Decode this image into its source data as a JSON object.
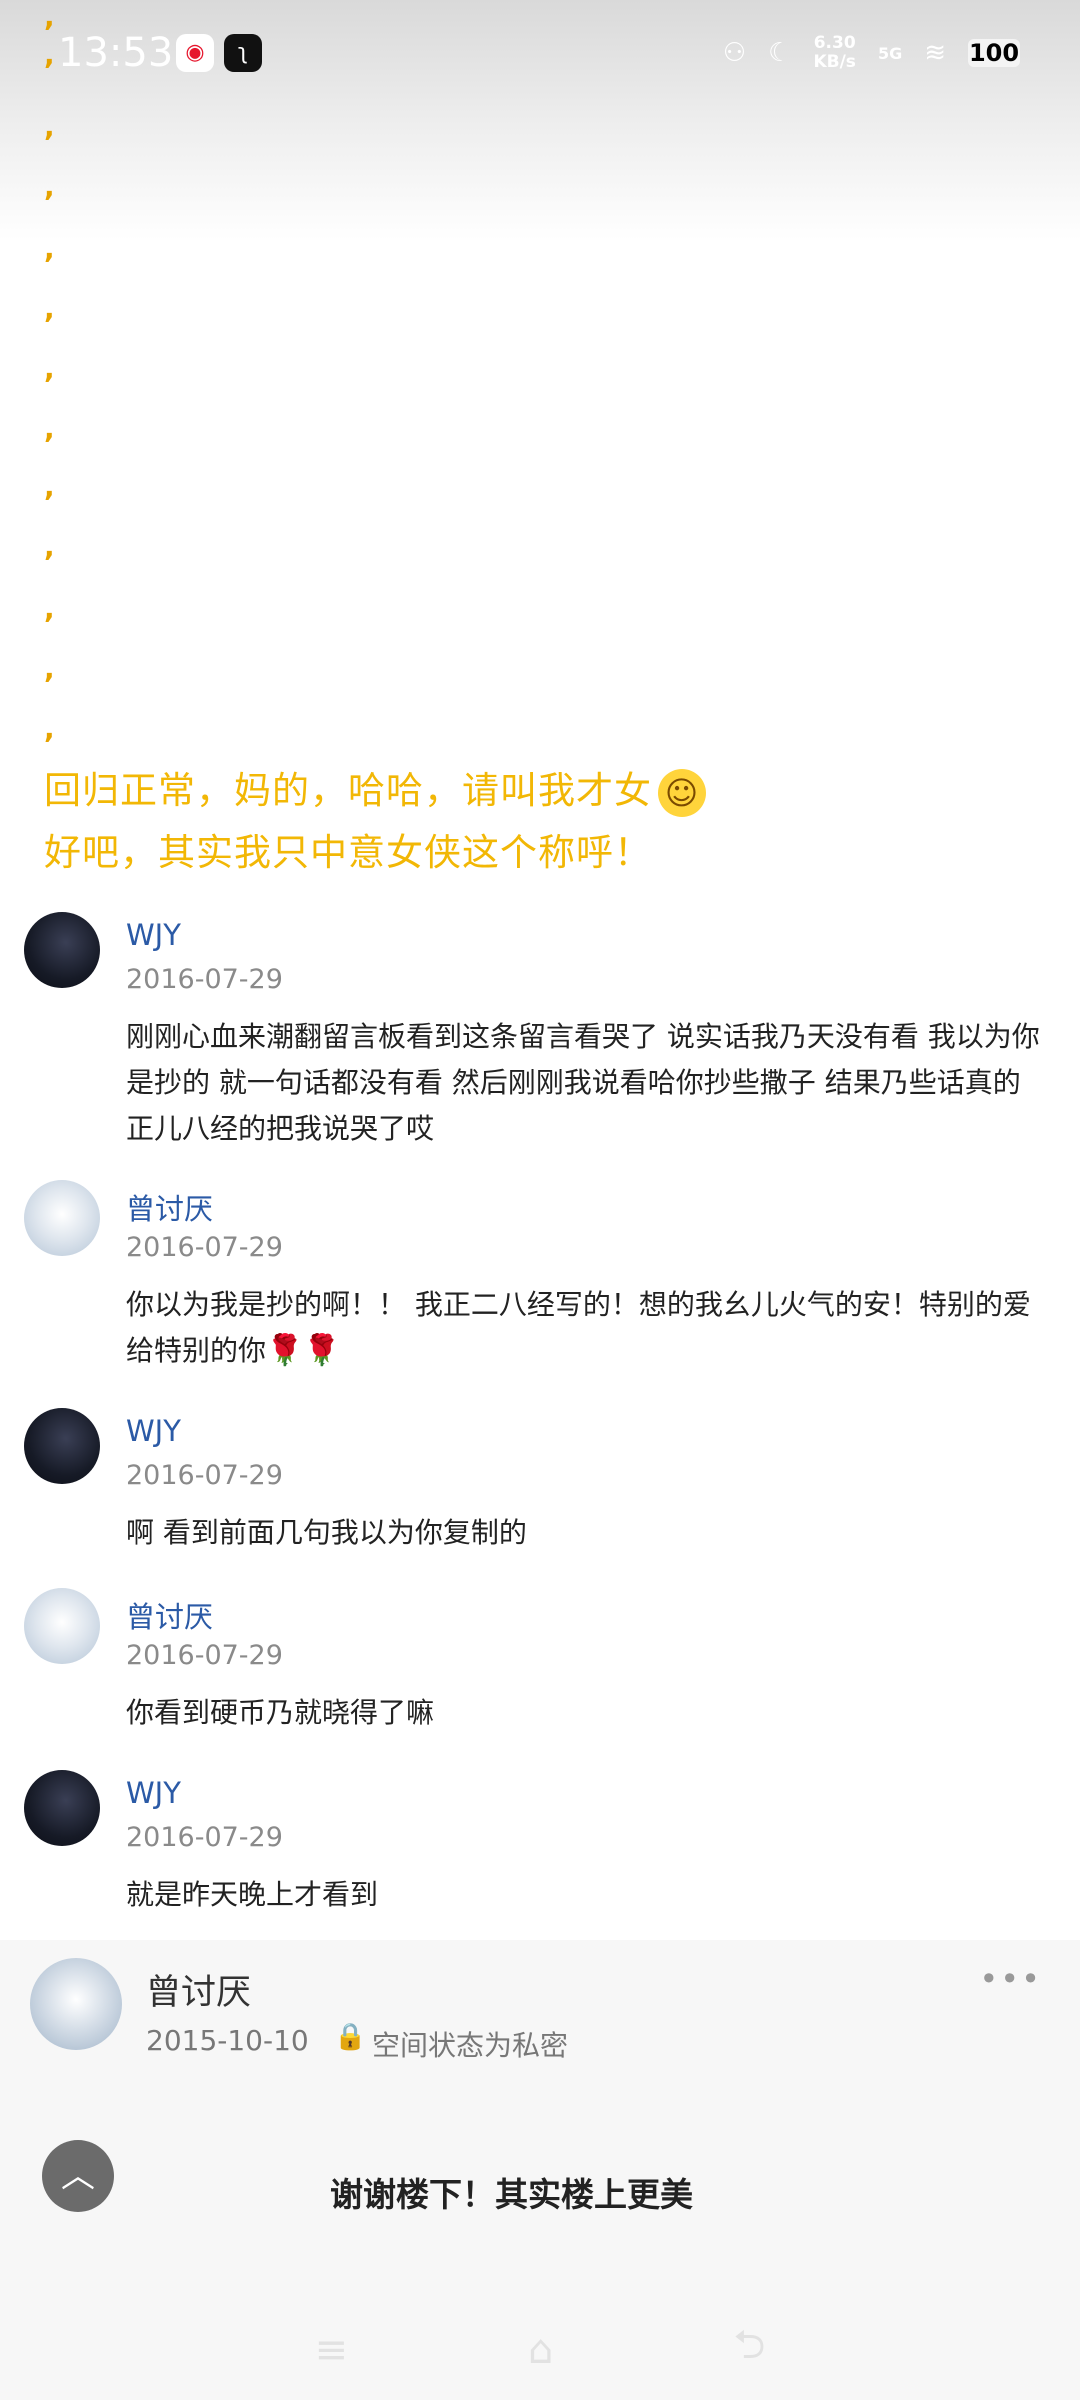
{
  "status_bar": {
    "time": "13:53",
    "speed_value": "6.30",
    "speed_unit": "KB/s",
    "network": "5G",
    "battery": "100"
  },
  "commas": [
    ",",
    ",",
    ",",
    ",",
    ",",
    ",",
    ",",
    ",",
    ",",
    ",",
    ",",
    ",",
    ","
  ],
  "highlight": {
    "line1": "回归正常，妈的，哈哈，请叫我才女",
    "line2": "好吧，其实我只中意女侠这个称呼！"
  },
  "comments": [
    {
      "name": "WJY",
      "date": "2016-07-29",
      "text": "刚刚心血来潮翻留言板看到这条留言看哭了 说实话我乃天没有看 我以为你是抄的 就一句话都没有看 然后刚刚我说看哈你抄些撒子 结果乃些话真的 正儿八经的把我说哭了哎"
    },
    {
      "name": "曾讨厌",
      "date": "2016-07-29",
      "text": "你以为我是抄的啊！！ 我正二八经写的！想的我幺儿火气的安！特别的爱给特别的你",
      "roses": "🌹🌹"
    },
    {
      "name": "WJY",
      "date": "2016-07-29",
      "text": "啊 看到前面几句我以为你复制的"
    },
    {
      "name": "曾讨厌",
      "date": "2016-07-29",
      "text": "你看到硬币乃就晓得了嘛"
    },
    {
      "name": "WJY",
      "date": "2016-07-29",
      "text": "就是昨天晚上才看到"
    }
  ],
  "post": {
    "name": "曾讨厌",
    "date": "2015-10-10",
    "privacy": "空间状态为私密",
    "text": "谢谢楼下！其实楼上更美"
  }
}
